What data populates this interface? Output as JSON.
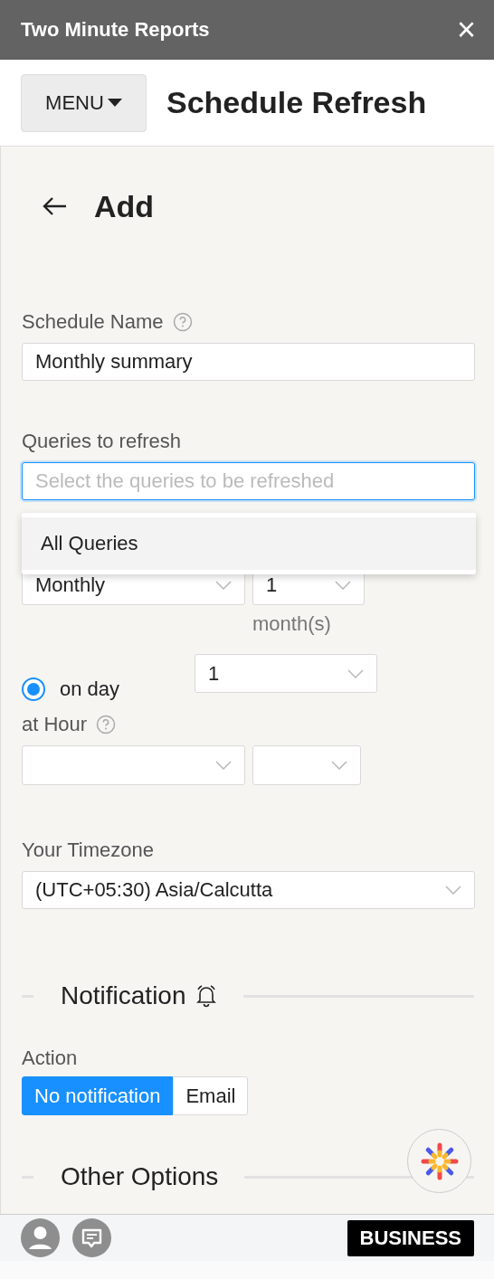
{
  "window": {
    "title": "Two Minute Reports",
    "close": "×"
  },
  "menu": {
    "label": "MENU",
    "page_title": "Schedule Refresh"
  },
  "section_title": "Add",
  "schedule_name": {
    "label": "Schedule Name",
    "value": "Monthly summary"
  },
  "queries": {
    "label": "Queries to refresh",
    "placeholder": "Select the queries to be refreshed",
    "focused": true,
    "options": [
      {
        "label": "All Queries",
        "selected": false
      }
    ]
  },
  "repeat": {
    "frequency": "Monthly",
    "every": "1",
    "unit": "month(s)"
  },
  "on_day": {
    "label": "on day",
    "selected": true,
    "day": "1"
  },
  "at_hour": {
    "label": "at Hour"
  },
  "timezone": {
    "label": "Your Timezone",
    "value": "(UTC+05:30) Asia/Calcutta"
  },
  "notification": {
    "heading": "Notification",
    "action_label": "Action",
    "options": [
      {
        "label": "No notification",
        "selected": true
      },
      {
        "label": "Email",
        "selected": false
      }
    ]
  },
  "other_options": {
    "heading": "Other Options"
  },
  "footer": {
    "plan": "BUSINESS"
  }
}
